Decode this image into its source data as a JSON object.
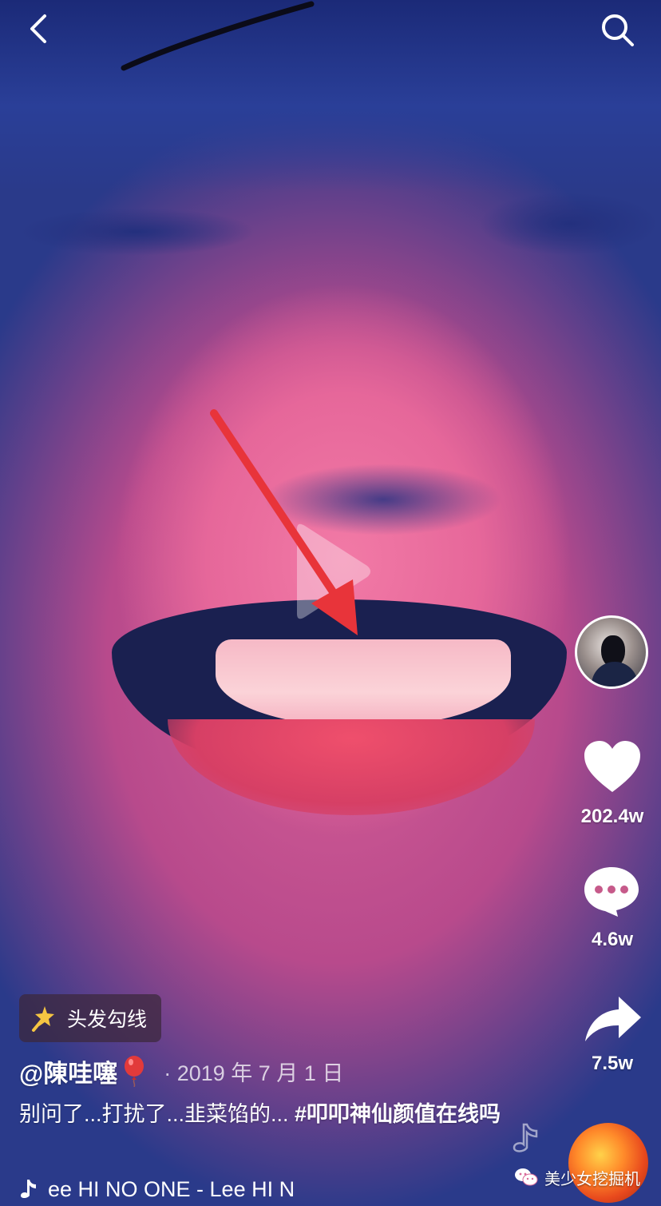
{
  "video": {
    "effect_label": "头发勾线",
    "username": "@陳哇噻",
    "date": "· 2019 年 7 月 1 日",
    "caption_text": "别问了...打扰了...韭菜馅的... ",
    "caption_hashtag": "#叩叩神仙颜值在线吗",
    "music_text": "ee HI    NO ONE - Lee HI    N"
  },
  "actions": {
    "like_count": "202.4w",
    "comment_count": "4.6w",
    "share_count": "7.5w"
  },
  "watermark": {
    "text": "美少女挖掘机"
  },
  "icons": {
    "back": "chevron-left-icon",
    "search": "search-icon",
    "like": "heart-icon",
    "comment": "comment-icon",
    "share": "share-icon",
    "music": "music-note-icon"
  },
  "colors": {
    "annotation_arrow": "#e8343a",
    "white": "#ffffff"
  }
}
